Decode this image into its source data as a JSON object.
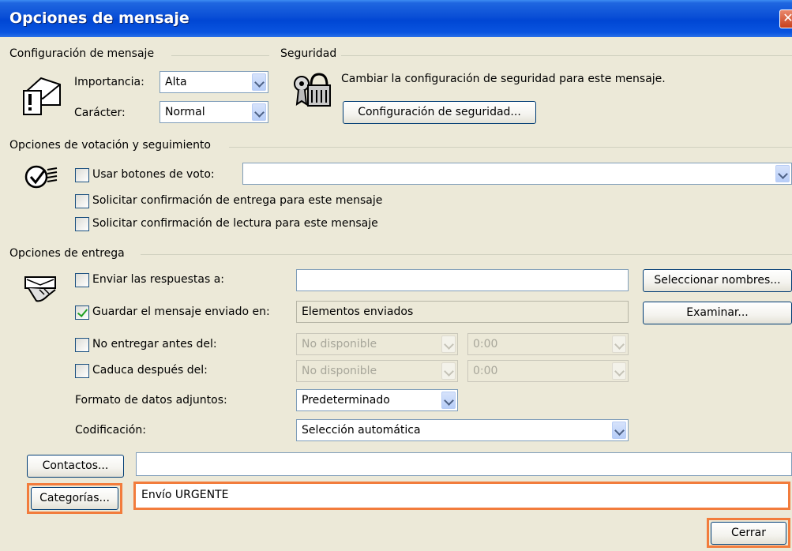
{
  "window": {
    "title": "Opciones de mensaje",
    "close_glyph": "✕"
  },
  "config": {
    "heading": "Configuración de mensaje",
    "importance_label": "Importancia:",
    "importance_value": "Alta",
    "sensitivity_label": "Carácter:",
    "sensitivity_value": "Normal"
  },
  "security": {
    "heading": "Seguridad",
    "description": "Cambiar la configuración de seguridad para este mensaje.",
    "button": "Configuración de seguridad..."
  },
  "voting": {
    "heading": "Opciones de votación y seguimiento",
    "use_voting_label": "Usar botones de voto:",
    "use_voting_value": "",
    "delivery_receipt_label": "Solicitar confirmación de entrega para este mensaje",
    "read_receipt_label": "Solicitar confirmación de lectura para este mensaje"
  },
  "delivery": {
    "heading": "Opciones de entrega",
    "replies_label": "Enviar las respuestas a:",
    "replies_value": "",
    "select_names_button": "Seleccionar nombres...",
    "save_sent_label": "Guardar el mensaje enviado en:",
    "save_sent_value": "Elementos enviados",
    "browse_button": "Examinar...",
    "no_deliver_before_label": "No entregar antes del:",
    "no_deliver_before_date": "No disponible",
    "no_deliver_before_time": "0:00",
    "expires_after_label": "Caduca después del:",
    "expires_after_date": "No disponible",
    "expires_after_time": "0:00",
    "attachment_format_label": "Formato de datos adjuntos:",
    "attachment_format_value": "Predeterminado",
    "encoding_label": "Codificación:",
    "encoding_value": "Selección automática"
  },
  "bottom": {
    "contacts_button": "Contactos...",
    "contacts_value": "",
    "categories_button": "Categorías...",
    "categories_value": "Envío URGENTE",
    "close_button": "Cerrar"
  },
  "colors": {
    "highlight": "#f27c3c",
    "title_bar": "#0a4fd6",
    "dialog_bg": "#ece9d8"
  }
}
